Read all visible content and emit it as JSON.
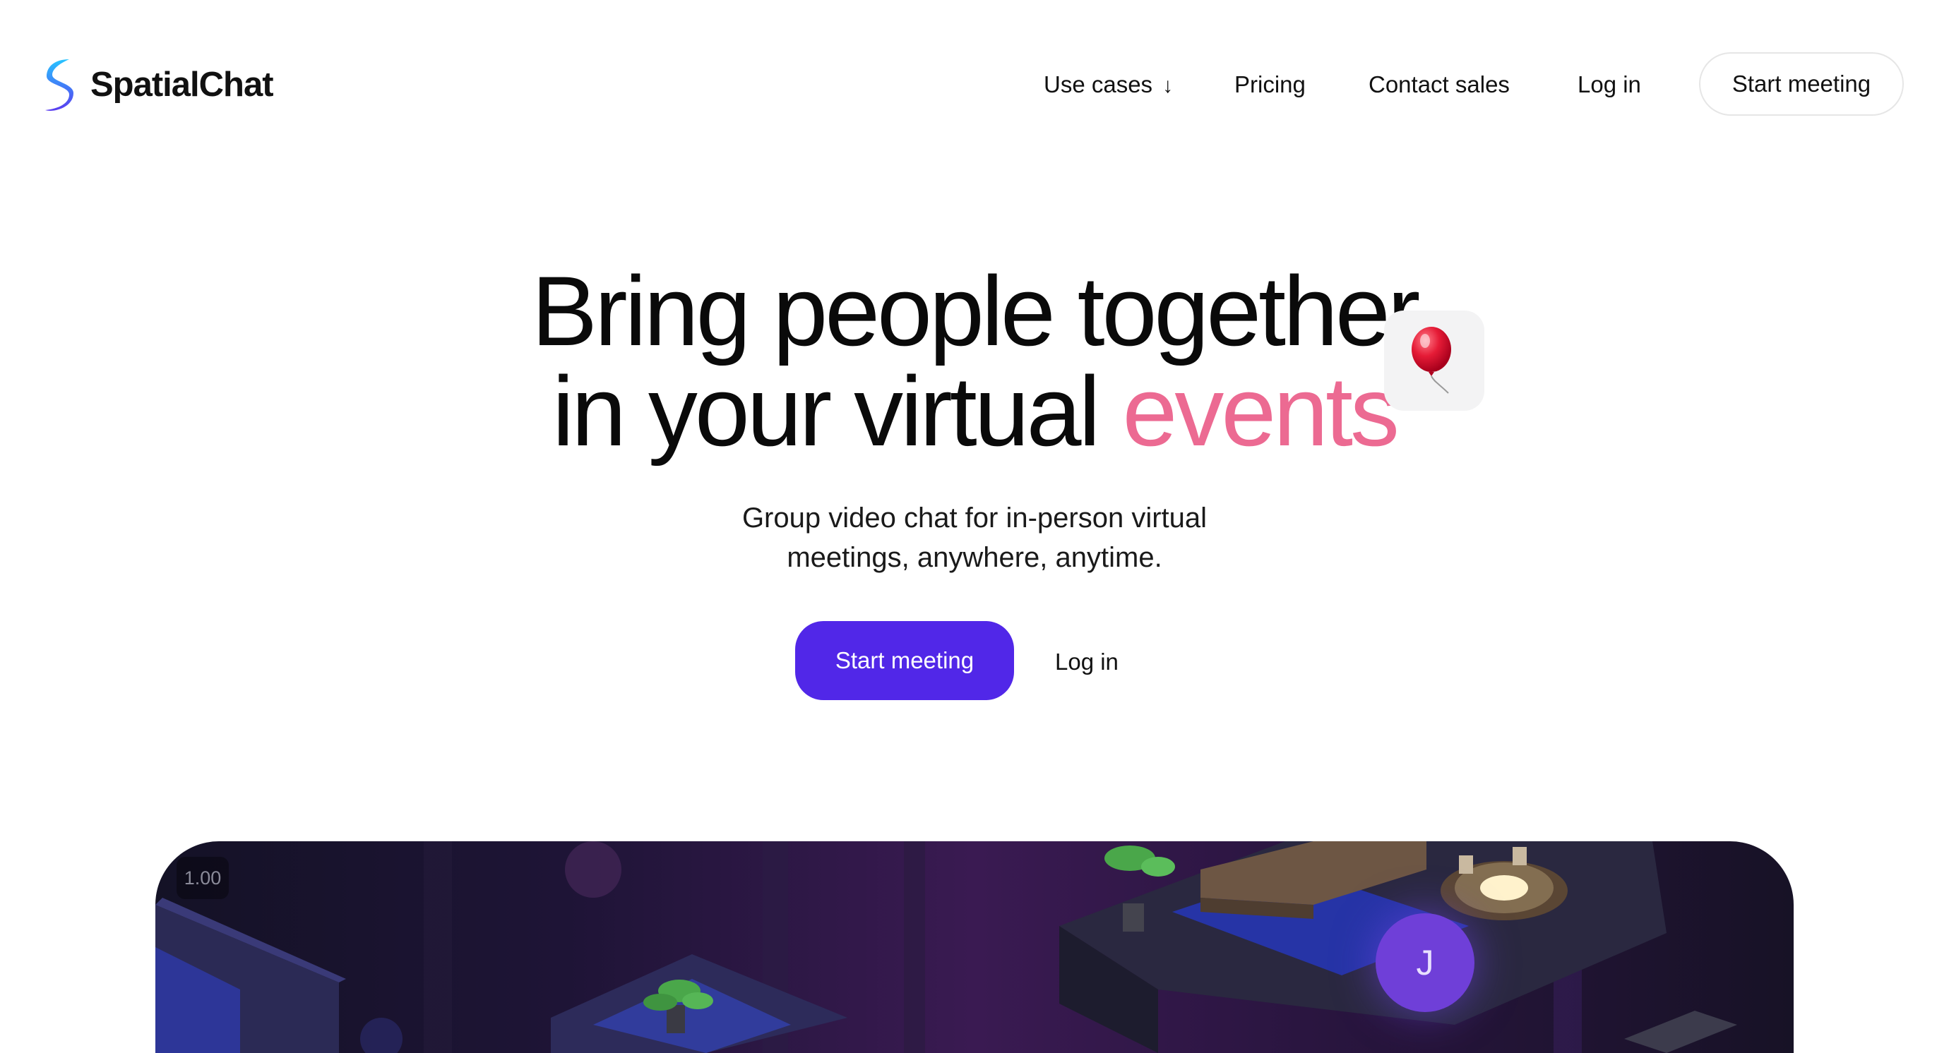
{
  "header": {
    "brand": "SpatialChat",
    "nav": {
      "use_cases": "Use cases",
      "use_cases_arrow": "↓",
      "pricing": "Pricing",
      "contact_sales": "Contact sales",
      "log_in": "Log in"
    },
    "cta": "Start meeting"
  },
  "hero": {
    "headline_line1": "Bring people together",
    "headline_line2_prefix": "in your virtual",
    "headline_accent": "events",
    "subtitle_line1": "Group video chat for in-person virtual",
    "subtitle_line2": "meetings, anywhere, anytime.",
    "primary_cta": "Start meeting",
    "secondary_cta": "Log in"
  },
  "scene": {
    "zoom_level": "1.00",
    "avatar_initial": "J"
  },
  "colors": {
    "brand_purple": "#5127e8",
    "accent_pink": "#ec6a92",
    "logo_blue": "#2a9dff",
    "logo_violet": "#6c3ff0"
  },
  "icons": {
    "logo": "spatialchat-logo-icon",
    "balloon": "balloon-icon",
    "dropdown": "arrow-down-icon"
  }
}
